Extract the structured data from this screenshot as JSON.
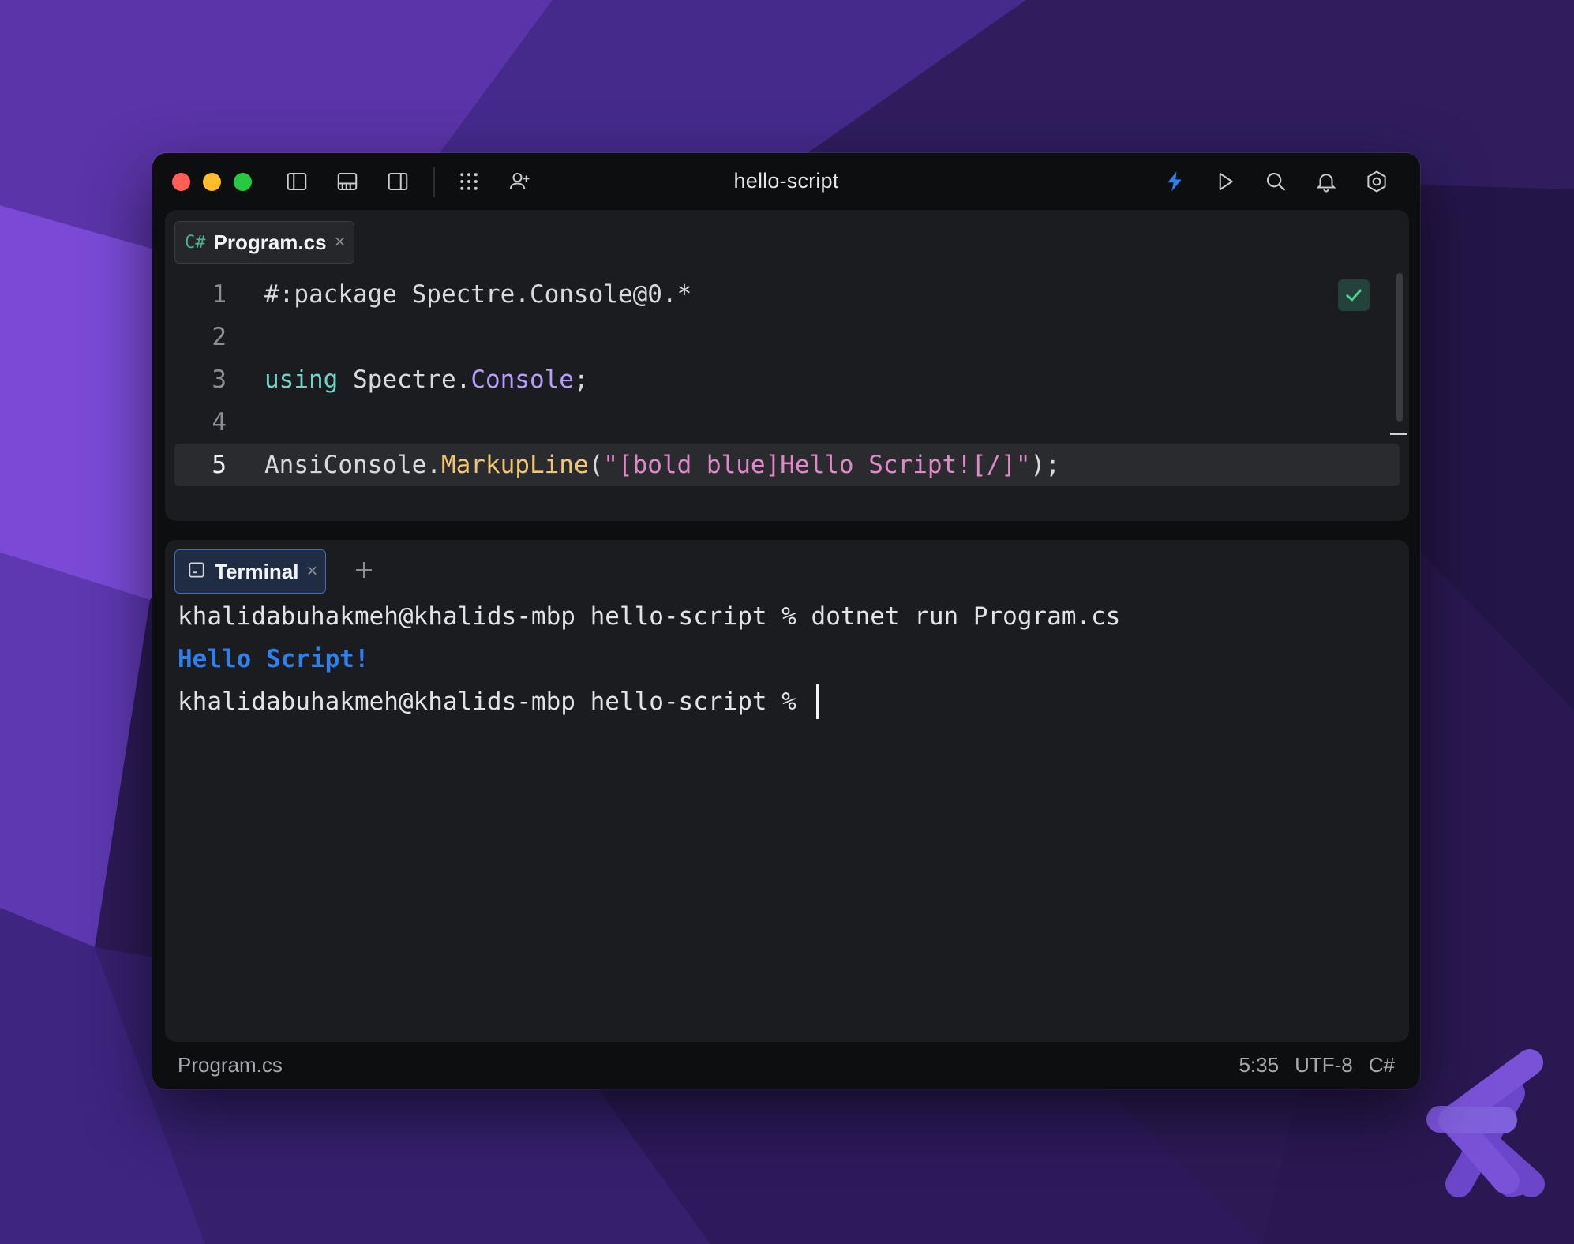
{
  "window": {
    "title": "hello-script"
  },
  "editor": {
    "tab": {
      "lang": "C#",
      "name": "Program.cs",
      "close": "×"
    },
    "lines": [
      {
        "n": "1",
        "text": "#:package Spectre.Console@0.*"
      },
      {
        "n": "2",
        "text": ""
      },
      {
        "n": "3",
        "kw": "using",
        "ns": " Spectre.",
        "cls": "Console",
        "end": ";"
      },
      {
        "n": "4",
        "text": ""
      },
      {
        "n": "5",
        "obj": "AnsiConsole.",
        "fn": "MarkupLine",
        "open": "(",
        "str": "\"[bold blue]Hello Script![/]\"",
        "close": ");"
      }
    ]
  },
  "terminal": {
    "tab": {
      "name": "Terminal",
      "close": "×"
    },
    "lines": [
      "khalidabuhakmeh@khalids-mbp hello-script % dotnet run Program.cs",
      "Hello Script!",
      "khalidabuhakmeh@khalids-mbp hello-script % "
    ]
  },
  "status": {
    "file": "Program.cs",
    "position": "5:35",
    "encoding": "UTF-8",
    "language": "C#"
  },
  "colors": {
    "accent": "#2f80ed",
    "keyword": "#6fd3c6",
    "class": "#b79cff",
    "function": "#f0c674",
    "string": "#e089c9"
  },
  "icons": [
    "sidebar-left-icon",
    "panel-bottom-icon",
    "sidebar-right-icon",
    "grid-icon",
    "add-user-icon",
    "lightning-icon",
    "run-icon",
    "search-icon",
    "bell-icon",
    "settings-icon",
    "check-icon",
    "terminal-icon",
    "plus-icon"
  ]
}
